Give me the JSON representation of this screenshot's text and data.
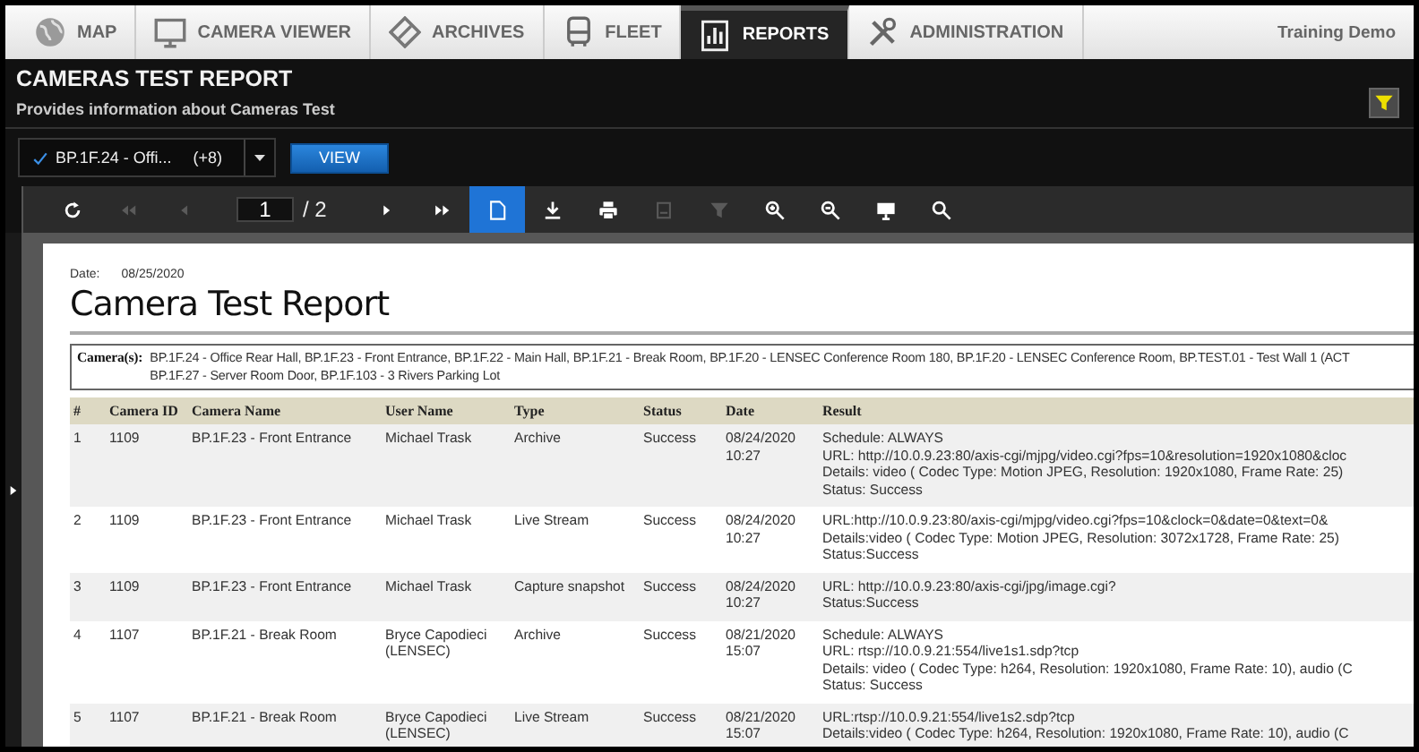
{
  "nav": {
    "tabs": [
      {
        "kind": "globe",
        "label": "MAP",
        "selected": false
      },
      {
        "kind": "monitor",
        "label": "CAMERA VIEWER",
        "selected": false
      },
      {
        "kind": "diamond",
        "label": "ARCHIVES",
        "selected": false
      },
      {
        "kind": "bus",
        "label": "FLEET",
        "selected": false
      },
      {
        "kind": "chart",
        "label": "REPORTS",
        "selected": true
      },
      {
        "kind": "tools",
        "label": "ADMINISTRATION",
        "selected": false
      }
    ],
    "account": "Training Demo"
  },
  "header": {
    "title": "CAMERAS TEST REPORT",
    "subtitle": "Provides information about Cameras Test"
  },
  "selector": {
    "value": "BP.1F.24 - Offi...",
    "count": "(+8)",
    "checked": true,
    "button": "VIEW"
  },
  "toolbar": [
    {
      "kind": "refresh",
      "disabled": false,
      "selected": false
    },
    {
      "kind": "first",
      "disabled": true,
      "selected": false
    },
    {
      "kind": "prev",
      "disabled": true,
      "selected": false
    },
    {
      "kind": "page",
      "value": "1",
      "total": "/ 2"
    },
    {
      "kind": "next",
      "disabled": false,
      "selected": false
    },
    {
      "kind": "last",
      "disabled": false,
      "selected": false
    },
    {
      "kind": "document",
      "disabled": false,
      "selected": true
    },
    {
      "kind": "download",
      "disabled": false,
      "selected": false
    },
    {
      "kind": "print",
      "disabled": false,
      "selected": false
    },
    {
      "kind": "save",
      "disabled": true,
      "selected": false
    },
    {
      "kind": "filter",
      "disabled": true,
      "selected": false
    },
    {
      "kind": "zoom-in",
      "disabled": false,
      "selected": false
    },
    {
      "kind": "zoom-out",
      "disabled": false,
      "selected": false
    },
    {
      "kind": "screen",
      "disabled": false,
      "selected": false
    },
    {
      "kind": "search",
      "disabled": false,
      "selected": false
    }
  ],
  "report": {
    "date_label": "Date:",
    "date": "08/25/2020",
    "title": "Camera Test Report",
    "cameras_label": "Camera(s):",
    "cameras": [
      "BP.1F.24 - Office Rear Hall, BP.1F.23 - Front Entrance, BP.1F.22 - Main Hall, BP.1F.21 - Break Room, BP.1F.20 - LENSEC Conference Room 180, BP.1F.20 - LENSEC Conference Room, BP.TEST.01 - Test Wall 1 (ACT",
      "BP.1F.27 - Server Room Door, BP.1F.103 - 3 Rivers Parking Lot"
    ],
    "table": {
      "columns": [
        "#",
        "Camera ID",
        "Camera Name",
        "User Name",
        "Type",
        "Status",
        "Date",
        "Result"
      ],
      "rows": [
        {
          "num": "1",
          "camera_id": "1109",
          "camera_name": "BP.1F.23 - Front Entrance",
          "user_name": "Michael Trask",
          "type": "Archive",
          "status": "Success",
          "date": "08/24/2020",
          "time": "10:27",
          "result": [
            "Schedule: ALWAYS",
            "URL: http://10.0.9.23:80/axis-cgi/mjpg/video.cgi?fps=10&resolution=1920x1080&cloc",
            "Details: video ( Codec Type: Motion JPEG, Resolution: 1920x1080, Frame Rate: 25)",
            "Status: Success"
          ]
        },
        {
          "num": "2",
          "camera_id": "1109",
          "camera_name": "BP.1F.23 - Front Entrance",
          "user_name": "Michael Trask",
          "type": "Live Stream",
          "status": "Success",
          "date": "08/24/2020",
          "time": "10:27",
          "result": [
            "URL:http://10.0.9.23:80/axis-cgi/mjpg/video.cgi?fps=10&clock=0&date=0&text=0&",
            "Details:video ( Codec Type: Motion JPEG, Resolution: 3072x1728, Frame Rate: 25)",
            "Status:Success"
          ]
        },
        {
          "num": "3",
          "camera_id": "1109",
          "camera_name": "BP.1F.23 - Front Entrance",
          "user_name": "Michael Trask",
          "type": "Capture snapshot",
          "status": "Success",
          "date": "08/24/2020",
          "time": "10:27",
          "result": [
            "URL: http://10.0.9.23:80/axis-cgi/jpg/image.cgi?",
            "Status:Success"
          ]
        },
        {
          "num": "4",
          "camera_id": "1107",
          "camera_name": "BP.1F.21 - Break Room",
          "user_name": "Bryce Capodieci (LENSEC)",
          "type": "Archive",
          "status": "Success",
          "date": "08/21/2020",
          "time": "15:07",
          "result": [
            "Schedule: ALWAYS",
            "URL: rtsp://10.0.9.21:554/live1s1.sdp?tcp",
            "Details: video ( Codec Type: h264, Resolution: 1920x1080, Frame Rate: 10),  audio (C",
            "Status: Success"
          ]
        },
        {
          "num": "5",
          "camera_id": "1107",
          "camera_name": "BP.1F.21 - Break Room",
          "user_name": "Bryce Capodieci (LENSEC)",
          "type": "Live Stream",
          "status": "Success",
          "date": "08/21/2020",
          "time": "15:07",
          "result": [
            "URL:rtsp://10.0.9.21:554/live1s2.sdp?tcp",
            "Details:video ( Codec Type: h264, Resolution: 1920x1080, Frame Rate: 10),  audio (C"
          ]
        }
      ]
    }
  }
}
